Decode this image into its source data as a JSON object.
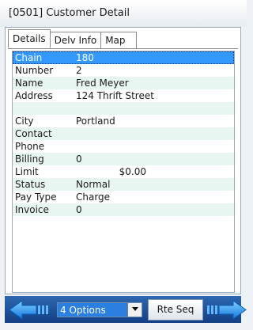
{
  "window": {
    "title": "[0501]  Customer Detail"
  },
  "tabs": [
    {
      "label": "Details",
      "active": true
    },
    {
      "label": "Delv Info",
      "active": false
    },
    {
      "label": "Map",
      "active": false
    }
  ],
  "details": [
    {
      "label": "Chain",
      "value": "180"
    },
    {
      "label": "Number",
      "value": "2"
    },
    {
      "label": "Name",
      "value": "Fred Meyer"
    },
    {
      "label": "Address",
      "value": "124 Thrift Street"
    },
    {
      "label": "",
      "value": ""
    },
    {
      "label": "City",
      "value": "Portland"
    },
    {
      "label": "Contact",
      "value": ""
    },
    {
      "label": "Phone",
      "value": ""
    },
    {
      "label": "Billing",
      "value": "0"
    },
    {
      "label": "Limit",
      "value": "$0.00"
    },
    {
      "label": "Status",
      "value": "Normal"
    },
    {
      "label": "Pay Type",
      "value": "Charge"
    },
    {
      "label": "Invoice",
      "value": "0"
    }
  ],
  "toolbar": {
    "options_value": "4 Options",
    "rte_seq_label": "Rte Seq"
  },
  "icons": {
    "prev": "arrow-left-icon",
    "next": "arrow-right-icon",
    "dropdown": "chevron-down-icon"
  },
  "colors": {
    "selection": "#3399ff",
    "alt_row": "#e8f6f2",
    "toolbar": "#1f4f98",
    "arrow": "#1e90ff"
  }
}
